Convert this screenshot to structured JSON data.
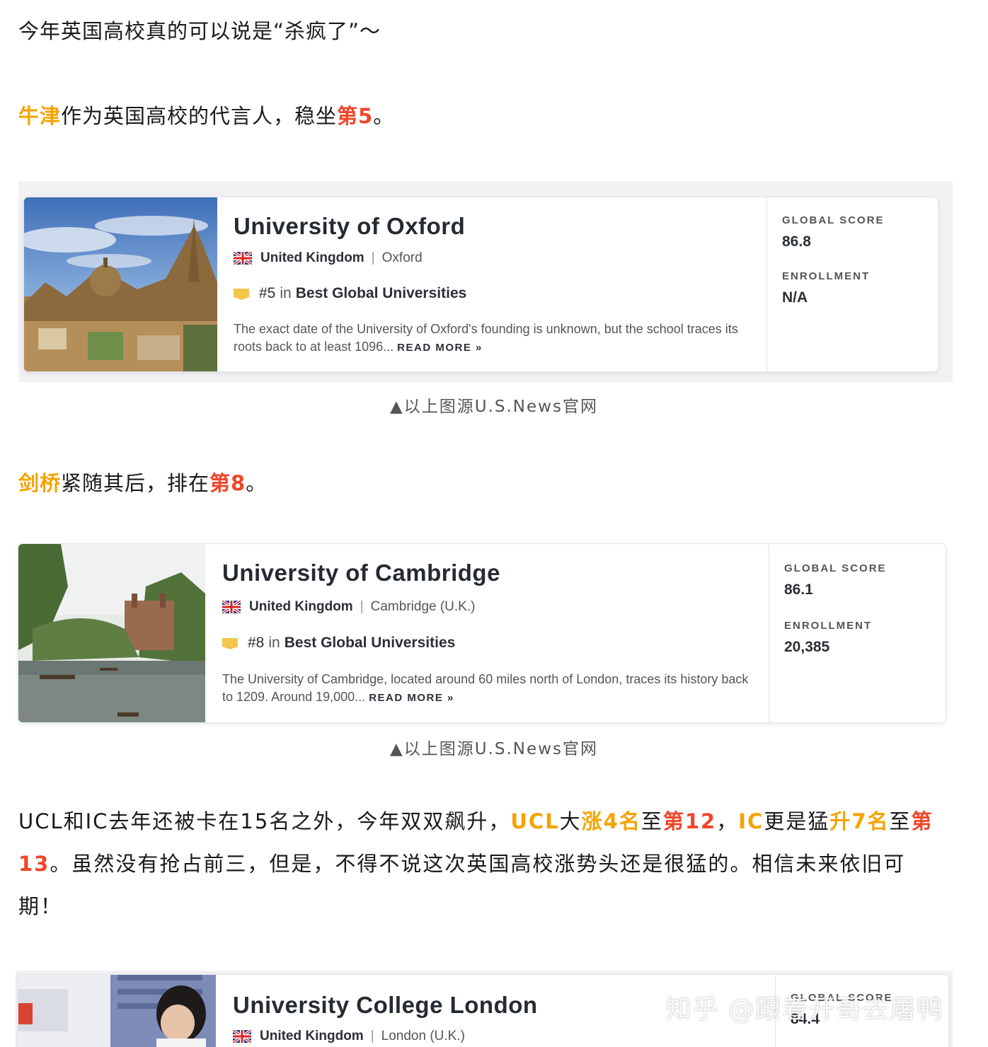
{
  "intro": {
    "text": "今年英国高校真的可以说是“杀疯了”～"
  },
  "oxford_para": {
    "name": "牛津",
    "mid": "作为英国高校的代言人，稳坐",
    "rank": "第5",
    "end": "。"
  },
  "cambridge_para": {
    "name": "剑桥",
    "mid": "紧随其后，排在",
    "rank": "第8",
    "end": "。"
  },
  "ucl_para": {
    "p1": "UCL和IC去年还被卡在15名之外，今年双双飙升，",
    "ucl": "UCL",
    "p2": "大",
    "rise1": "涨4名",
    "p3": "至",
    "rank1": "第12",
    "p4": "，",
    "ic": "IC",
    "p5": "更是猛",
    "rise2": "升7名",
    "p6": "至",
    "rank2a": "第",
    "rank2b": "13",
    "p7": "。虽然没有抢占前三，但是，不得不说这次英国高校涨势头还是很猛的。相信未来依旧可",
    "p8": "期！"
  },
  "caption": "▲以上图源U.S.News官网",
  "cards": [
    {
      "name": "University of Oxford",
      "country": "United Kingdom",
      "city": "Oxford",
      "rank": "#5",
      "in": "in",
      "category": "Best Global Universities",
      "desc": "The exact date of the University of Oxford's founding is unknown, but the school traces its roots back to at least 1096...",
      "read_more": "READ MORE »",
      "score_label": "GLOBAL SCORE",
      "score": "86.8",
      "enroll_label": "ENROLLMENT",
      "enroll": "N/A"
    },
    {
      "name": "University of Cambridge",
      "country": "United Kingdom",
      "city": "Cambridge (U.K.)",
      "rank": "#8",
      "in": "in",
      "category": "Best Global Universities",
      "desc": "The University of Cambridge, located around 60 miles north of London, traces its history back to 1209. Around 19,000...",
      "read_more": "READ MORE »",
      "score_label": "GLOBAL SCORE",
      "score": "86.1",
      "enroll_label": "ENROLLMENT",
      "enroll": "20,385"
    },
    {
      "name": "University College London",
      "country": "United Kingdom",
      "city": "London (U.K.)",
      "score_label": "GLOBAL SCORE",
      "score": "84.4"
    }
  ],
  "watermark": "知乎 @跟着开哥去屠鸭",
  "colors": {
    "highlight_orange": "#f5a300",
    "highlight_red": "#f0452a"
  },
  "icons": [
    "uk-flag-icon",
    "ranking-badge-icon"
  ]
}
